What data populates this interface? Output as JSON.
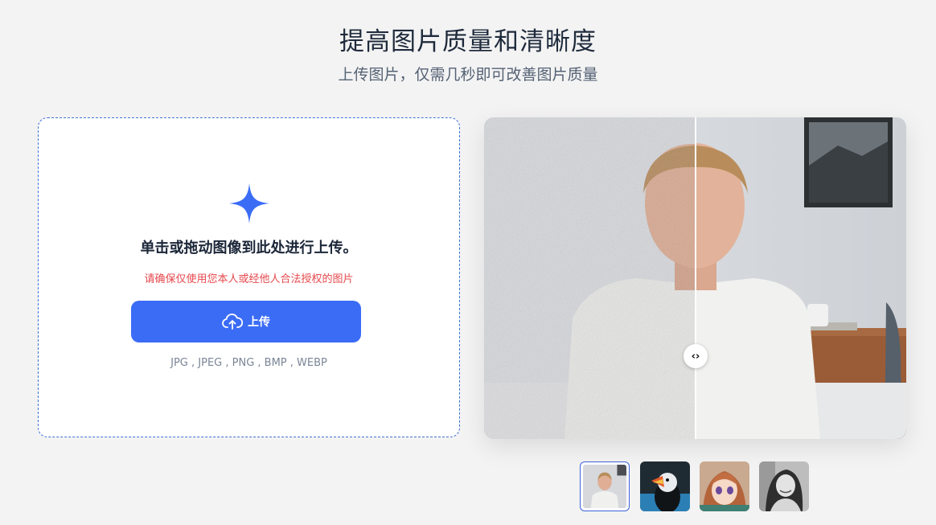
{
  "header": {
    "title": "提高图片质量和清晰度",
    "subtitle": "上传图片，仅需几秒即可改善图片质量"
  },
  "upload": {
    "heading": "单击或拖动图像到此处进行上传。",
    "notice": "请确保仅使用您本人或经他人合法授权的图片",
    "button_label": "上传",
    "formats": "JPG , JPEG , PNG , BMP , WEBP"
  },
  "compare": {
    "handle_glyph": "‹›"
  },
  "samples": [
    {
      "name": "young man portrait",
      "active": true
    },
    {
      "name": "puffin bird",
      "active": false
    },
    {
      "name": "anime girl",
      "active": false
    },
    {
      "name": "black and white woman portrait",
      "active": false
    }
  ],
  "colors": {
    "accent": "#3b6cf6",
    "notice": "#e5484d",
    "background": "#f3f3f3"
  }
}
